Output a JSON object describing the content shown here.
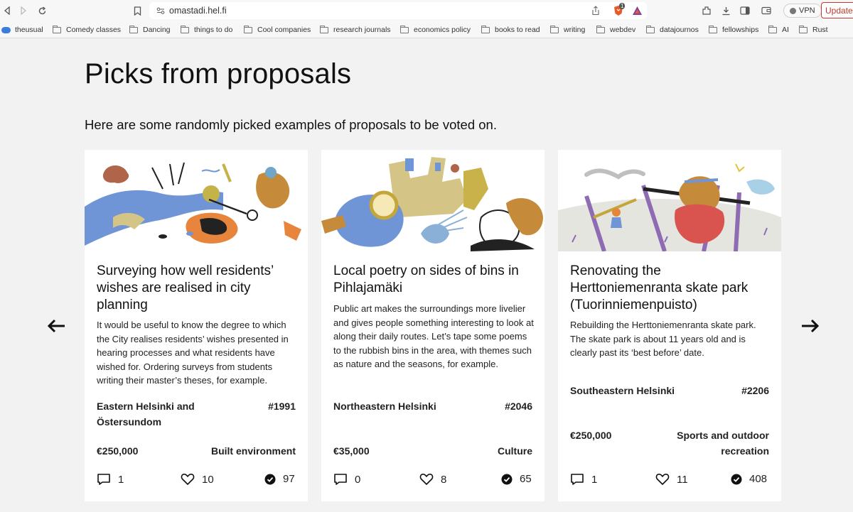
{
  "browser": {
    "url": "omastadi.hel.fi",
    "shield_badge": "1",
    "vpn_label": "VPN",
    "update_label": "Update",
    "bookmarks": [
      {
        "label": "theusual",
        "icon": "cloud-icon"
      },
      {
        "label": "Comedy classes",
        "icon": "folder-icon"
      },
      {
        "label": "Dancing",
        "icon": "folder-icon"
      },
      {
        "label": "things to do",
        "icon": "folder-icon"
      },
      {
        "label": "Cool companies",
        "icon": "folder-icon"
      },
      {
        "label": "research journals",
        "icon": "folder-icon"
      },
      {
        "label": "economics policy",
        "icon": "folder-icon"
      },
      {
        "label": "books to read",
        "icon": "folder-icon"
      },
      {
        "label": "writing",
        "icon": "folder-icon"
      },
      {
        "label": "webdev",
        "icon": "folder-icon"
      },
      {
        "label": "datajournos",
        "icon": "folder-icon"
      },
      {
        "label": "fellowships",
        "icon": "folder-icon"
      },
      {
        "label": "AI",
        "icon": "folder-icon"
      },
      {
        "label": "Rust",
        "icon": "folder-icon"
      }
    ]
  },
  "page": {
    "heading": "Picks from proposals",
    "intro": "Here are some randomly picked examples of proposals to be voted on."
  },
  "cards": [
    {
      "title": "Surveying how well residents’ wishes are realised in city planning",
      "description": "It would be useful to know the degree to which the City realises residents’ wishes presented in hearing processes and what residents have wished for. Ordering surveys from students writing their master’s theses, for example.",
      "district": "Eastern Helsinki and Östersundom",
      "number": "#1991",
      "budget": "€250,000",
      "theme": "Built environment",
      "comments": "1",
      "likes": "10",
      "votes": "97"
    },
    {
      "title": "Local poetry on sides of bins in Pihlajamäki",
      "description": "Public art makes the surroundings more livelier and gives people something interesting to look at along their daily routes. Let’s tape some poems to the rubbish bins in the area, with themes such as nature and the seasons, for example.",
      "district": "Northeastern Helsinki",
      "number": "#2046",
      "budget": "€35,000",
      "theme": "Culture",
      "comments": "0",
      "likes": "8",
      "votes": "65"
    },
    {
      "title": "Renovating the Herttoniemenranta skate park (Tuorinniemenpuisto)",
      "description": "Rebuilding the Herttoniemenranta skate park. The skate park is about 11 years old and is clearly past its ‘best before’ date.",
      "district": "Southeastern Helsinki",
      "number": "#2206",
      "budget": "€250,000",
      "theme": "Sports and outdoor recreation",
      "comments": "1",
      "likes": "11",
      "votes": "408"
    }
  ],
  "colors": {
    "page_bg": "#f2f2f2",
    "card_bg": "#ffffff",
    "update_red": "#c0392b",
    "illus_blue": "#6f95d6",
    "illus_orange": "#e8853c",
    "illus_sand": "#d4c486",
    "illus_purple": "#8f6bb3"
  }
}
